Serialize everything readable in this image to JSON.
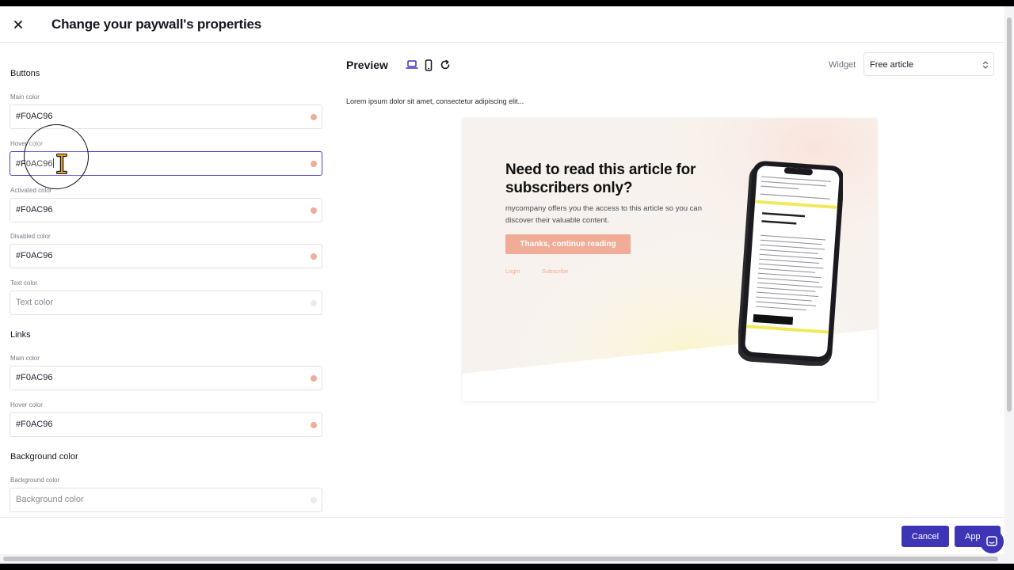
{
  "header": {
    "title": "Change your paywall's properties"
  },
  "buttons_section": {
    "title": "Buttons",
    "main_color": {
      "label": "Main color",
      "value": "#F0AC96"
    },
    "hover_color": {
      "label": "Hover color",
      "value": "#F0AC96"
    },
    "activated_color": {
      "label": "Activated color",
      "value": "#F0AC96"
    },
    "disabled_color": {
      "label": "Disabled color",
      "value": "#F0AC96"
    },
    "text_color": {
      "label": "Text color",
      "placeholder": "Text color"
    }
  },
  "links_section": {
    "title": "Links",
    "main_color": {
      "label": "Main color",
      "value": "#F0AC96"
    },
    "hover_color": {
      "label": "Hover color",
      "value": "#F0AC96"
    }
  },
  "background_section": {
    "title": "Background color",
    "background_color": {
      "label": "Background color",
      "placeholder": "Background color"
    }
  },
  "preview": {
    "title": "Preview",
    "widget_label": "Widget",
    "widget_value": "Free article",
    "lorem": "Lorem ipsum dolor sit amet, consectetur adipiscing elit...",
    "paywall": {
      "heading": "Need to read this article for subscribers only?",
      "body": "mycompany offers you the access to this article so you can discover their valuable content.",
      "button": "Thanks, continue reading",
      "login": "Login",
      "subscribe": "Subscribe"
    }
  },
  "footer": {
    "cancel": "Cancel",
    "apply": "App"
  },
  "colors": {
    "accent": "#3d35b5",
    "swatch": "#f0ac96",
    "focus_border": "#4b3fbf"
  }
}
